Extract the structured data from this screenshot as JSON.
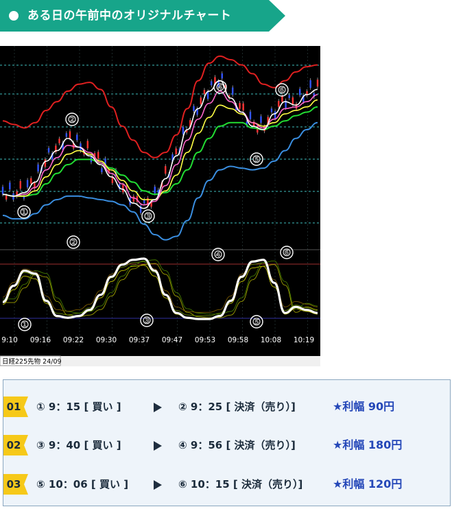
{
  "header": {
    "title": "ある日の午前中のオリジナルチャート",
    "colors": {
      "banner": "#17a58a",
      "dot": "#ffffff"
    }
  },
  "chart_data": {
    "type": "line",
    "x_tick_labels": [
      "9:10",
      "09:16",
      "09:22",
      "09:30",
      "09:37",
      "09:47",
      "09:53",
      "09:58",
      "10:08",
      "10:19"
    ],
    "footer_label": "日経225先物 24/09",
    "scroll_left_glyph": "◄",
    "scroll_right_glyph": "►",
    "price_markers": [
      "①",
      "②",
      "③",
      "④",
      "⑤",
      "⑥"
    ],
    "oscillator_markers": [
      "①",
      "②",
      "③",
      "④",
      "⑤",
      "⑥"
    ],
    "upper_band": [
      0.35,
      0.37,
      0.39,
      0.36,
      0.29,
      0.24,
      0.18,
      0.14,
      0.13,
      0.17,
      0.27,
      0.38,
      0.46,
      0.53,
      0.56,
      0.53,
      0.43,
      0.28,
      0.12,
      0.02,
      -0.02,
      0.0,
      0.03,
      0.08,
      0.14,
      0.16,
      0.12,
      0.07,
      0.04,
      0.03
    ],
    "lower_band": [
      0.89,
      0.91,
      0.91,
      0.88,
      0.83,
      0.8,
      0.78,
      0.78,
      0.79,
      0.8,
      0.81,
      0.83,
      0.87,
      0.94,
      1.0,
      1.03,
      1.01,
      0.92,
      0.79,
      0.69,
      0.63,
      0.61,
      0.62,
      0.63,
      0.62,
      0.58,
      0.52,
      0.45,
      0.4,
      0.36
    ],
    "ma_fast": [
      0.77,
      0.78,
      0.76,
      0.7,
      0.58,
      0.52,
      0.45,
      0.5,
      0.55,
      0.6,
      0.67,
      0.74,
      0.82,
      0.85,
      0.8,
      0.68,
      0.55,
      0.4,
      0.28,
      0.18,
      0.12,
      0.22,
      0.3,
      0.38,
      0.4,
      0.31,
      0.24,
      0.26,
      0.2,
      0.17
    ],
    "ma_mid": [
      0.77,
      0.78,
      0.77,
      0.73,
      0.63,
      0.56,
      0.49,
      0.5,
      0.53,
      0.59,
      0.65,
      0.71,
      0.79,
      0.83,
      0.81,
      0.72,
      0.6,
      0.46,
      0.34,
      0.25,
      0.18,
      0.24,
      0.3,
      0.36,
      0.39,
      0.34,
      0.28,
      0.27,
      0.24,
      0.2
    ],
    "ma_slow": [
      0.77,
      0.78,
      0.78,
      0.75,
      0.67,
      0.6,
      0.54,
      0.52,
      0.54,
      0.58,
      0.63,
      0.69,
      0.75,
      0.8,
      0.8,
      0.75,
      0.66,
      0.53,
      0.42,
      0.33,
      0.26,
      0.28,
      0.31,
      0.36,
      0.38,
      0.36,
      0.31,
      0.29,
      0.27,
      0.23
    ],
    "ma_green": [
      0.77,
      0.78,
      0.78,
      0.77,
      0.71,
      0.65,
      0.6,
      0.57,
      0.57,
      0.59,
      0.62,
      0.66,
      0.7,
      0.75,
      0.77,
      0.76,
      0.71,
      0.63,
      0.53,
      0.45,
      0.38,
      0.36,
      0.36,
      0.39,
      0.4,
      0.38,
      0.35,
      0.32,
      0.3,
      0.27
    ],
    "oscillator": [
      0.28,
      0.55,
      0.8,
      0.75,
      0.3,
      0.05,
      0.02,
      0.05,
      0.15,
      0.4,
      0.7,
      0.9,
      0.98,
      1.0,
      0.8,
      0.4,
      0.1,
      0.02,
      0.0,
      0.0,
      0.05,
      0.3,
      0.7,
      0.95,
      0.98,
      0.6,
      0.1,
      0.2,
      0.15,
      0.1
    ],
    "colors": {
      "background": "#000000",
      "upper_band": "#e02020",
      "lower_band": "#3a8ee0",
      "ma_fast": "#ffffff",
      "ma_mid": "#ff66cc",
      "ma_slow": "#ffff44",
      "ma_green": "#22dd33",
      "oscillator": "#ffffff",
      "guide_dashed": "#3fbfbf",
      "candle_up": "#ff3333",
      "candle_down": "#3355ff"
    }
  },
  "trades": [
    {
      "badge": "01",
      "buy": "① 9：15 [ 買い ]",
      "sell": "② 9：25 [ 決済（売り）]",
      "profit": "★利幅 90円"
    },
    {
      "badge": "02",
      "buy": "③ 9：40 [ 買い ]",
      "sell": "④ 9：56 [ 決済（売り）]",
      "profit": "★利幅 180円"
    },
    {
      "badge": "03",
      "buy": "⑤ 10：06 [ 買い ]",
      "sell": "⑥ 10：15 [ 決済（売り）]",
      "profit": "★利幅 120円"
    }
  ],
  "panel": {
    "colors": {
      "badge": "#f6c919",
      "profit": "#2447b8",
      "arrow": "#1f2e3f"
    }
  }
}
